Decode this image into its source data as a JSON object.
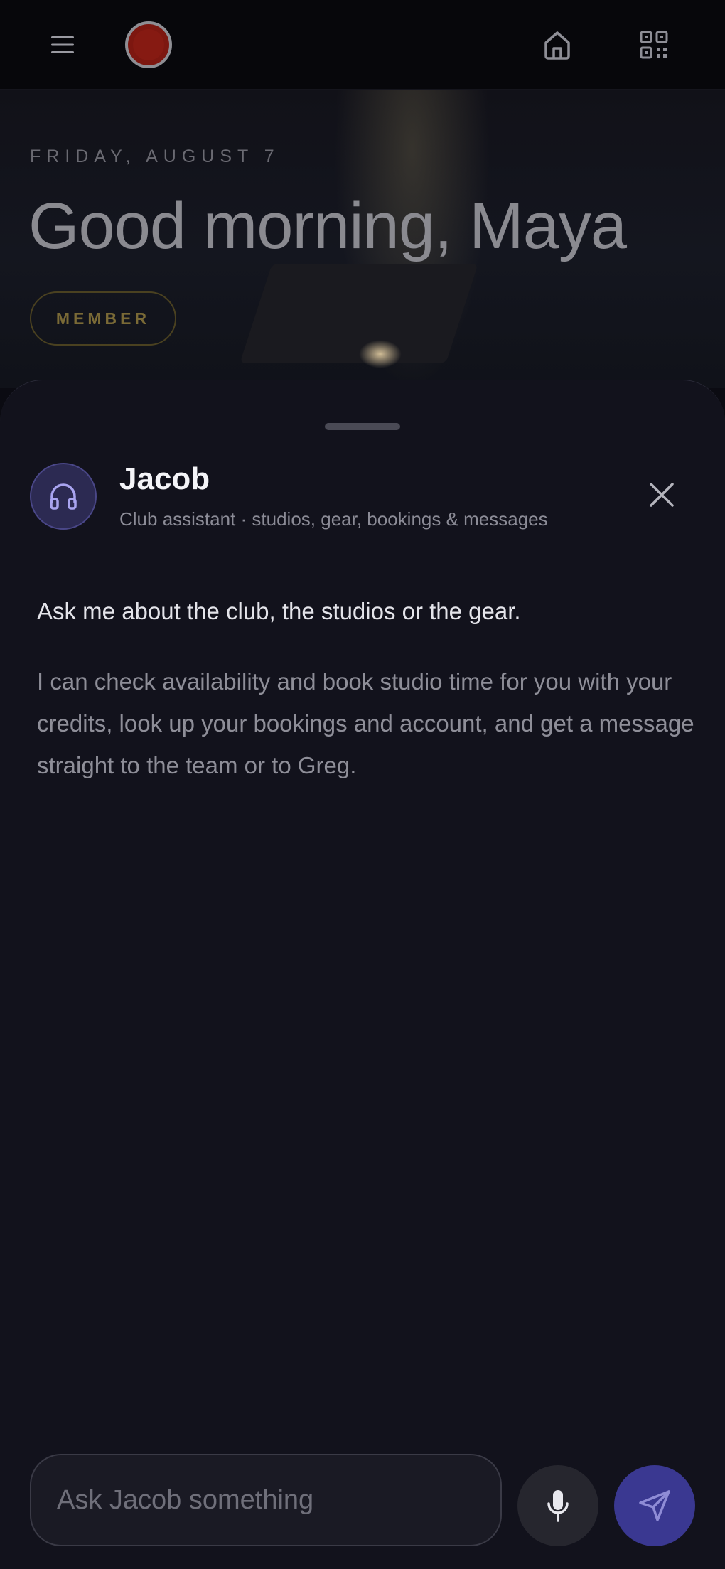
{
  "colors": {
    "background": "#0b0b12",
    "sheet": "#12121c",
    "accent": "#3a3891",
    "record": "#7d1710",
    "member_gold": "#7a6a36"
  },
  "topbar": {
    "menu_icon": "menu-icon",
    "record_icon": "record-icon",
    "home_icon": "home-icon",
    "qr_icon": "qr-code-icon"
  },
  "hero": {
    "date": "FRIDAY, AUGUST 7",
    "greeting": "Good morning, Maya",
    "badge": "MEMBER"
  },
  "assistant": {
    "avatar_icon": "headphones-icon",
    "name": "Jacob",
    "subtitle": "Club assistant · studios, gear, bookings & messages",
    "close_icon": "close-icon"
  },
  "intro": {
    "title": "Ask me about the club, the studios or the gear.",
    "body": "I can check availability and book studio time for you with your credits, look up your bookings and account, and get a message straight to the team or to Greg."
  },
  "composer": {
    "placeholder": "Ask Jacob something",
    "value": "",
    "mic_icon": "microphone-icon",
    "send_icon": "send-icon"
  }
}
